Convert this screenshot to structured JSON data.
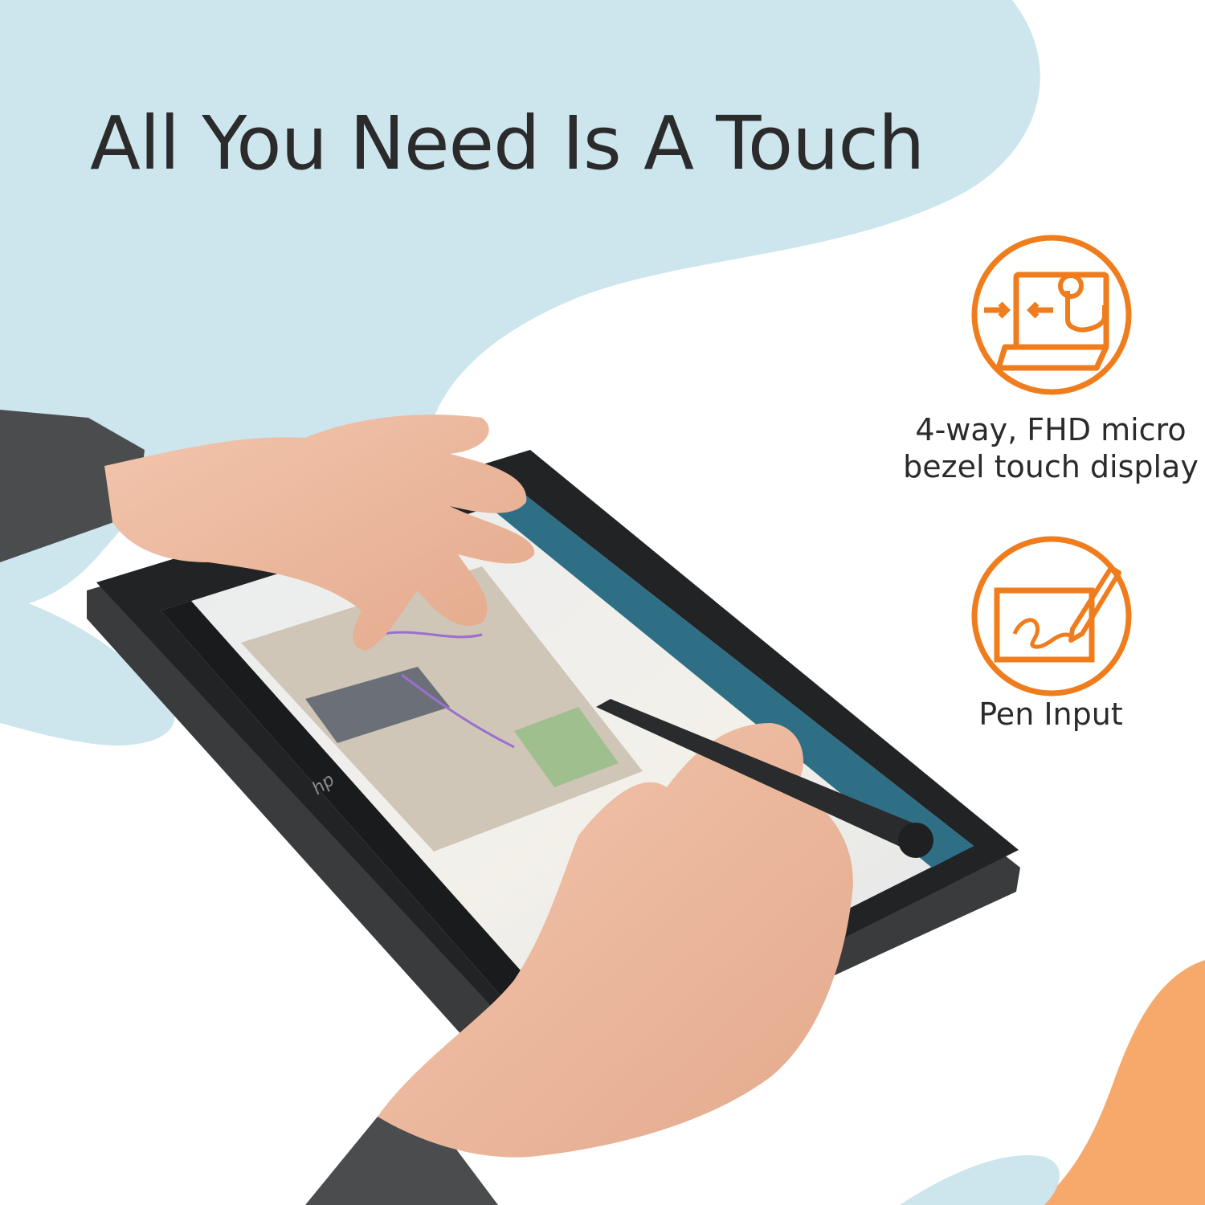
{
  "headline": "All You Need Is A Touch",
  "features": [
    {
      "icon": "touch-display-icon",
      "label_line1": "4-way, FHD micro",
      "label_line2": "bezel touch display"
    },
    {
      "icon": "pen-input-icon",
      "label_line1": "Pen Input",
      "label_line2": ""
    }
  ],
  "colors": {
    "accent": "#f07d1d",
    "headline_text": "#2b2b2b",
    "blob_blue": "#cde6ee",
    "blob_orange": "#f7a86b"
  },
  "device_logo": "hp"
}
